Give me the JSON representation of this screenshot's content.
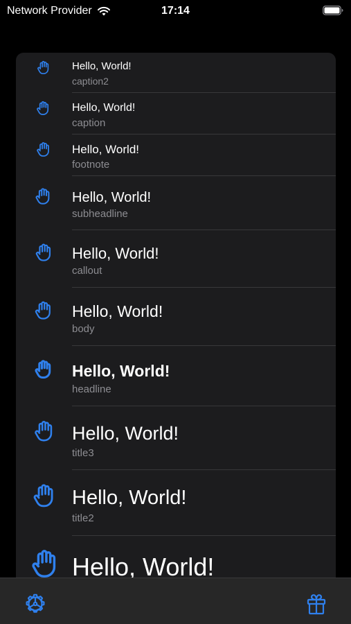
{
  "status_bar": {
    "carrier": "Network Provider",
    "time": "17:14"
  },
  "list": {
    "rows": [
      {
        "text": "Hello, World!",
        "style": "caption2"
      },
      {
        "text": "Hello, World!",
        "style": "caption"
      },
      {
        "text": "Hello, World!",
        "style": "footnote"
      },
      {
        "text": "Hello, World!",
        "style": "subheadline"
      },
      {
        "text": "Hello, World!",
        "style": "callout"
      },
      {
        "text": "Hello, World!",
        "style": "body"
      },
      {
        "text": "Hello, World!",
        "style": "headline"
      },
      {
        "text": "Hello, World!",
        "style": "title3"
      },
      {
        "text": "Hello, World!",
        "style": "title2"
      },
      {
        "text": "Hello, World!",
        "style": "title"
      }
    ]
  },
  "icons": {
    "row_icon": "hand-raised-icon",
    "settings": "gear-icon",
    "gift": "gift-icon"
  },
  "colors": {
    "accent": "#2f80ed",
    "background": "#000000",
    "card": "#1c1c1e",
    "secondary_text": "#8d8d92"
  }
}
